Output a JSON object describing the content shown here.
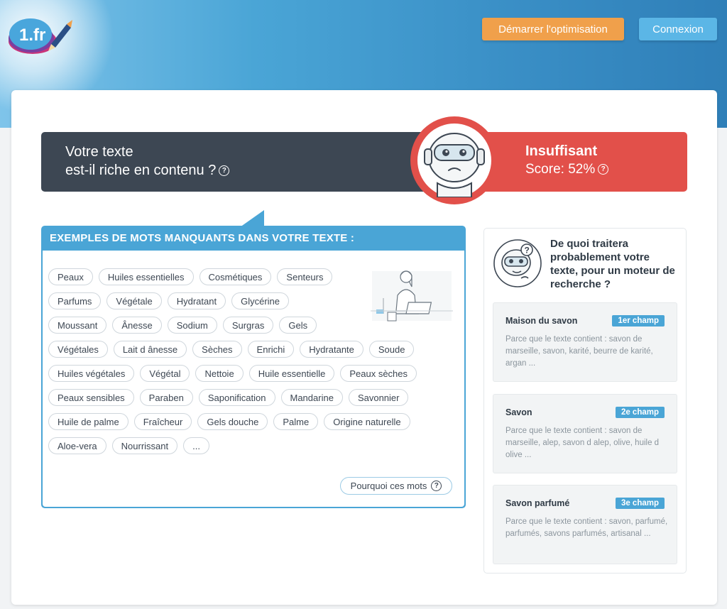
{
  "header": {
    "logo_text": "1.fr",
    "start_button": "Démarrer l'optimisation",
    "login_button": "Connexion"
  },
  "banner": {
    "question_line1": "Votre texte",
    "question_line2": "est-il riche en contenu ?",
    "rating": "Insuffisant",
    "score_label": "Score: 52%",
    "score_percent": 52,
    "colors": {
      "dark": "#3d4753",
      "alert": "#e2504a"
    }
  },
  "missing_words": {
    "title": "EXEMPLES DE MOTS MANQUANTS DANS VOTRE TEXTE :",
    "rows": [
      [
        "Peaux",
        "Huiles essentielles",
        "Cosmétiques",
        "Senteurs"
      ],
      [
        "Parfums",
        "Végétale",
        "Hydratant",
        "Glycérine"
      ],
      [
        "Moussant",
        "Ânesse",
        "Sodium",
        "Surgras",
        "Gels"
      ],
      [
        "Végétales",
        "Lait d ânesse",
        "Sèches",
        "Enrichi",
        "Hydratante",
        "Soude"
      ],
      [
        "Huiles végétales",
        "Végétal",
        "Nettoie",
        "Huile essentielle",
        "Peaux sèches"
      ],
      [
        "Peaux sensibles",
        "Paraben",
        "Saponification",
        "Mandarine",
        "Savonnier"
      ],
      [
        "Huile de palme",
        "Fraîcheur",
        "Gels douche",
        "Palme",
        "Origine naturelle"
      ],
      [
        "Aloe-vera",
        "Nourrissant",
        "..."
      ]
    ],
    "why_button": "Pourquoi ces mots"
  },
  "topics": {
    "question": "De quoi traitera probablement votre texte, pour un moteur de recherche ?",
    "items": [
      {
        "name": "Maison du savon",
        "rank": "1er champ",
        "desc": "Parce que le texte contient :   savon de marseille, savon, karité, beurre de karité, argan ..."
      },
      {
        "name": "Savon",
        "rank": "2e champ",
        "desc": "Parce que le texte contient :   savon de marseille, alep, savon d alep, olive, huile d olive ..."
      },
      {
        "name": "Savon parfumé",
        "rank": "3e champ",
        "desc": "Parce que le texte contient :   savon, parfumé, parfumés, savons parfumés, artisanal ..."
      }
    ]
  }
}
